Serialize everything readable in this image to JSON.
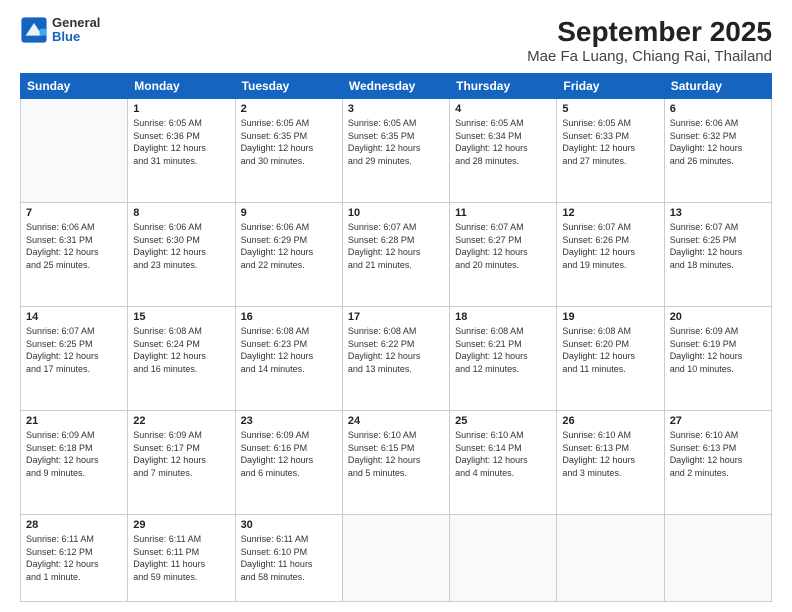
{
  "header": {
    "logo": {
      "general": "General",
      "blue": "Blue"
    },
    "title": "September 2025",
    "subtitle": "Mae Fa Luang, Chiang Rai, Thailand"
  },
  "weekdays": [
    "Sunday",
    "Monday",
    "Tuesday",
    "Wednesday",
    "Thursday",
    "Friday",
    "Saturday"
  ],
  "weeks": [
    [
      {
        "day": "",
        "info": ""
      },
      {
        "day": "1",
        "info": "Sunrise: 6:05 AM\nSunset: 6:36 PM\nDaylight: 12 hours\nand 31 minutes."
      },
      {
        "day": "2",
        "info": "Sunrise: 6:05 AM\nSunset: 6:35 PM\nDaylight: 12 hours\nand 30 minutes."
      },
      {
        "day": "3",
        "info": "Sunrise: 6:05 AM\nSunset: 6:35 PM\nDaylight: 12 hours\nand 29 minutes."
      },
      {
        "day": "4",
        "info": "Sunrise: 6:05 AM\nSunset: 6:34 PM\nDaylight: 12 hours\nand 28 minutes."
      },
      {
        "day": "5",
        "info": "Sunrise: 6:05 AM\nSunset: 6:33 PM\nDaylight: 12 hours\nand 27 minutes."
      },
      {
        "day": "6",
        "info": "Sunrise: 6:06 AM\nSunset: 6:32 PM\nDaylight: 12 hours\nand 26 minutes."
      }
    ],
    [
      {
        "day": "7",
        "info": "Sunrise: 6:06 AM\nSunset: 6:31 PM\nDaylight: 12 hours\nand 25 minutes."
      },
      {
        "day": "8",
        "info": "Sunrise: 6:06 AM\nSunset: 6:30 PM\nDaylight: 12 hours\nand 23 minutes."
      },
      {
        "day": "9",
        "info": "Sunrise: 6:06 AM\nSunset: 6:29 PM\nDaylight: 12 hours\nand 22 minutes."
      },
      {
        "day": "10",
        "info": "Sunrise: 6:07 AM\nSunset: 6:28 PM\nDaylight: 12 hours\nand 21 minutes."
      },
      {
        "day": "11",
        "info": "Sunrise: 6:07 AM\nSunset: 6:27 PM\nDaylight: 12 hours\nand 20 minutes."
      },
      {
        "day": "12",
        "info": "Sunrise: 6:07 AM\nSunset: 6:26 PM\nDaylight: 12 hours\nand 19 minutes."
      },
      {
        "day": "13",
        "info": "Sunrise: 6:07 AM\nSunset: 6:25 PM\nDaylight: 12 hours\nand 18 minutes."
      }
    ],
    [
      {
        "day": "14",
        "info": "Sunrise: 6:07 AM\nSunset: 6:25 PM\nDaylight: 12 hours\nand 17 minutes."
      },
      {
        "day": "15",
        "info": "Sunrise: 6:08 AM\nSunset: 6:24 PM\nDaylight: 12 hours\nand 16 minutes."
      },
      {
        "day": "16",
        "info": "Sunrise: 6:08 AM\nSunset: 6:23 PM\nDaylight: 12 hours\nand 14 minutes."
      },
      {
        "day": "17",
        "info": "Sunrise: 6:08 AM\nSunset: 6:22 PM\nDaylight: 12 hours\nand 13 minutes."
      },
      {
        "day": "18",
        "info": "Sunrise: 6:08 AM\nSunset: 6:21 PM\nDaylight: 12 hours\nand 12 minutes."
      },
      {
        "day": "19",
        "info": "Sunrise: 6:08 AM\nSunset: 6:20 PM\nDaylight: 12 hours\nand 11 minutes."
      },
      {
        "day": "20",
        "info": "Sunrise: 6:09 AM\nSunset: 6:19 PM\nDaylight: 12 hours\nand 10 minutes."
      }
    ],
    [
      {
        "day": "21",
        "info": "Sunrise: 6:09 AM\nSunset: 6:18 PM\nDaylight: 12 hours\nand 9 minutes."
      },
      {
        "day": "22",
        "info": "Sunrise: 6:09 AM\nSunset: 6:17 PM\nDaylight: 12 hours\nand 7 minutes."
      },
      {
        "day": "23",
        "info": "Sunrise: 6:09 AM\nSunset: 6:16 PM\nDaylight: 12 hours\nand 6 minutes."
      },
      {
        "day": "24",
        "info": "Sunrise: 6:10 AM\nSunset: 6:15 PM\nDaylight: 12 hours\nand 5 minutes."
      },
      {
        "day": "25",
        "info": "Sunrise: 6:10 AM\nSunset: 6:14 PM\nDaylight: 12 hours\nand 4 minutes."
      },
      {
        "day": "26",
        "info": "Sunrise: 6:10 AM\nSunset: 6:13 PM\nDaylight: 12 hours\nand 3 minutes."
      },
      {
        "day": "27",
        "info": "Sunrise: 6:10 AM\nSunset: 6:13 PM\nDaylight: 12 hours\nand 2 minutes."
      }
    ],
    [
      {
        "day": "28",
        "info": "Sunrise: 6:11 AM\nSunset: 6:12 PM\nDaylight: 12 hours\nand 1 minute."
      },
      {
        "day": "29",
        "info": "Sunrise: 6:11 AM\nSunset: 6:11 PM\nDaylight: 11 hours\nand 59 minutes."
      },
      {
        "day": "30",
        "info": "Sunrise: 6:11 AM\nSunset: 6:10 PM\nDaylight: 11 hours\nand 58 minutes."
      },
      {
        "day": "",
        "info": ""
      },
      {
        "day": "",
        "info": ""
      },
      {
        "day": "",
        "info": ""
      },
      {
        "day": "",
        "info": ""
      }
    ]
  ]
}
